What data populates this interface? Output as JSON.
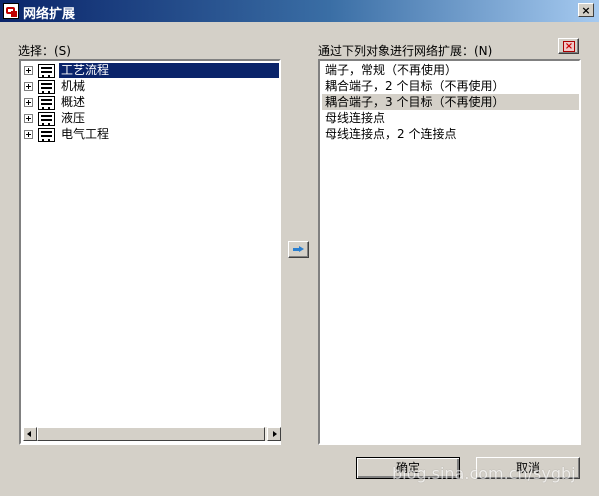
{
  "window": {
    "title": "网络扩展",
    "icon": "app-icon",
    "close_glyph": "×"
  },
  "left_panel": {
    "label": "选择：(S)",
    "tree": [
      {
        "label": "工艺流程",
        "selected": true
      },
      {
        "label": "机械",
        "selected": false
      },
      {
        "label": "概述",
        "selected": false
      },
      {
        "label": "液压",
        "selected": false
      },
      {
        "label": "电气工程",
        "selected": false
      }
    ]
  },
  "right_panel": {
    "label": "通过下列对象进行网络扩展：(N)",
    "delete_glyph": "×",
    "items": [
      {
        "label": "端子，常规（不再使用）",
        "highlighted": false
      },
      {
        "label": "耦合端子，2 个目标（不再使用）",
        "highlighted": false
      },
      {
        "label": "耦合端子，3 个目标（不再使用）",
        "highlighted": true
      },
      {
        "label": "母线连接点",
        "highlighted": false
      },
      {
        "label": "母线连接点，2 个连接点",
        "highlighted": false
      }
    ]
  },
  "buttons": {
    "ok_label": "确定",
    "cancel_label": "取消"
  },
  "watermark": "blog.sina.com.cn/sygbj"
}
